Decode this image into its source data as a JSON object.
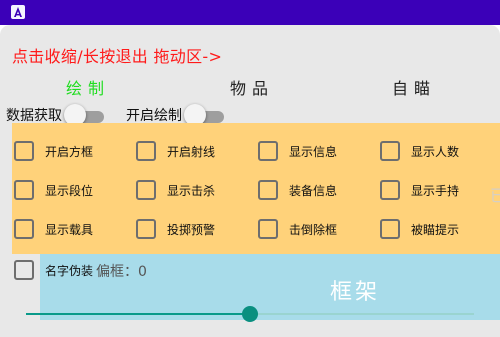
{
  "header": {
    "app_icon": "app-icon"
  },
  "panel": {
    "drag_hint": "点击收缩/长按退出 拖动区->"
  },
  "tabs": [
    {
      "label": "绘制",
      "active": true
    },
    {
      "label": "物品",
      "active": false
    },
    {
      "label": "自瞄",
      "active": false
    }
  ],
  "toggles": [
    {
      "label": "数据获取",
      "on": false
    },
    {
      "label": "开启绘制",
      "on": false
    }
  ],
  "options": [
    {
      "label": "开启方框",
      "checked": false
    },
    {
      "label": "开启射线",
      "checked": false
    },
    {
      "label": "显示信息",
      "checked": false
    },
    {
      "label": "显示人数",
      "checked": false
    },
    {
      "label": "显示段位",
      "checked": false
    },
    {
      "label": "显示击杀",
      "checked": false
    },
    {
      "label": "装备信息",
      "checked": false
    },
    {
      "label": "显示手持",
      "checked": false
    },
    {
      "label": "显示载具",
      "checked": false
    },
    {
      "label": "投掷预警",
      "checked": false
    },
    {
      "label": "击倒除框",
      "checked": false
    },
    {
      "label": "被瞄提示",
      "checked": false
    },
    {
      "label": "名字伪装",
      "checked": false
    }
  ],
  "offset": {
    "label": "偏框：0",
    "value": 0
  },
  "frame": {
    "title": "框架",
    "faint_char": "已"
  },
  "slider": {
    "fraction": 0.5
  },
  "colors": {
    "status_bar": "#3b00b8",
    "drag_hint": "#ff1a1a",
    "active_tab": "#22dd22",
    "orange_region": "#ffd27a",
    "blue_region": "#a8dcea",
    "slider_accent": "#0a8f80"
  }
}
